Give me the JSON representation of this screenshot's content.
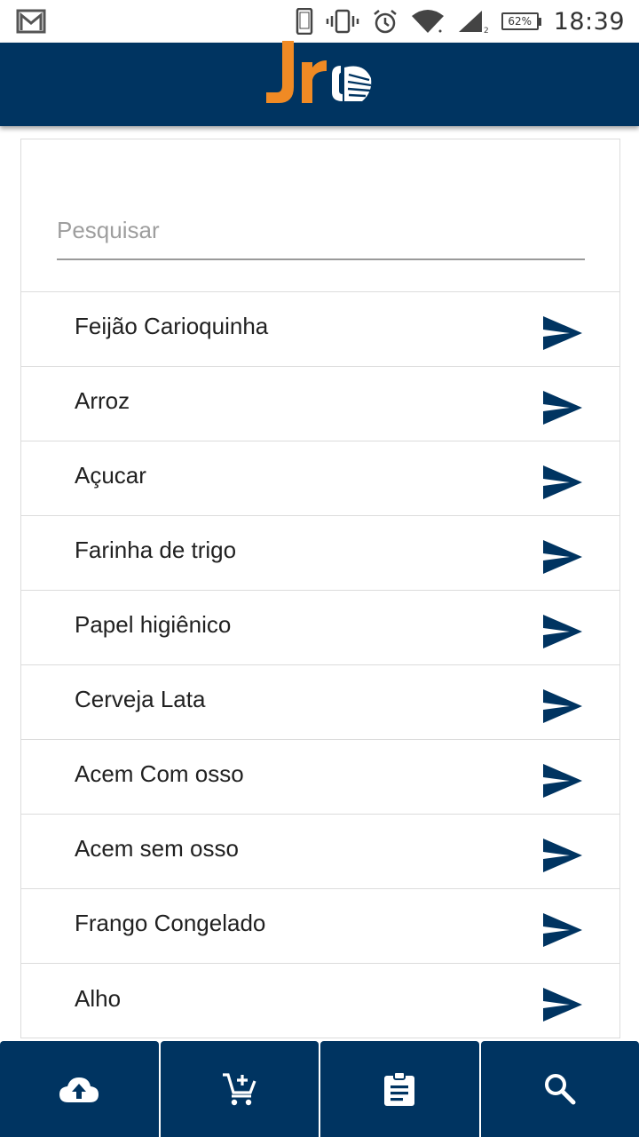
{
  "status_bar": {
    "battery": "62%",
    "time": "18:39"
  },
  "colors": {
    "primary": "#003461",
    "logo_orange": "#f08a24",
    "divider": "#dcdcdc"
  },
  "search": {
    "placeholder": "Pesquisar",
    "value": ""
  },
  "products": [
    {
      "name": "Feijão Carioquinha"
    },
    {
      "name": "Arroz"
    },
    {
      "name": "Açucar"
    },
    {
      "name": "Farinha de trigo"
    },
    {
      "name": "Papel higiênico"
    },
    {
      "name": "Cerveja Lata"
    },
    {
      "name": "Acem Com osso"
    },
    {
      "name": "Acem sem osso"
    },
    {
      "name": "Frango Congelado"
    },
    {
      "name": "Alho"
    }
  ],
  "bottom_nav": [
    {
      "icon": "cloud-upload-icon"
    },
    {
      "icon": "add-shopping-cart-icon"
    },
    {
      "icon": "clipboard-icon"
    },
    {
      "icon": "search-icon"
    }
  ]
}
